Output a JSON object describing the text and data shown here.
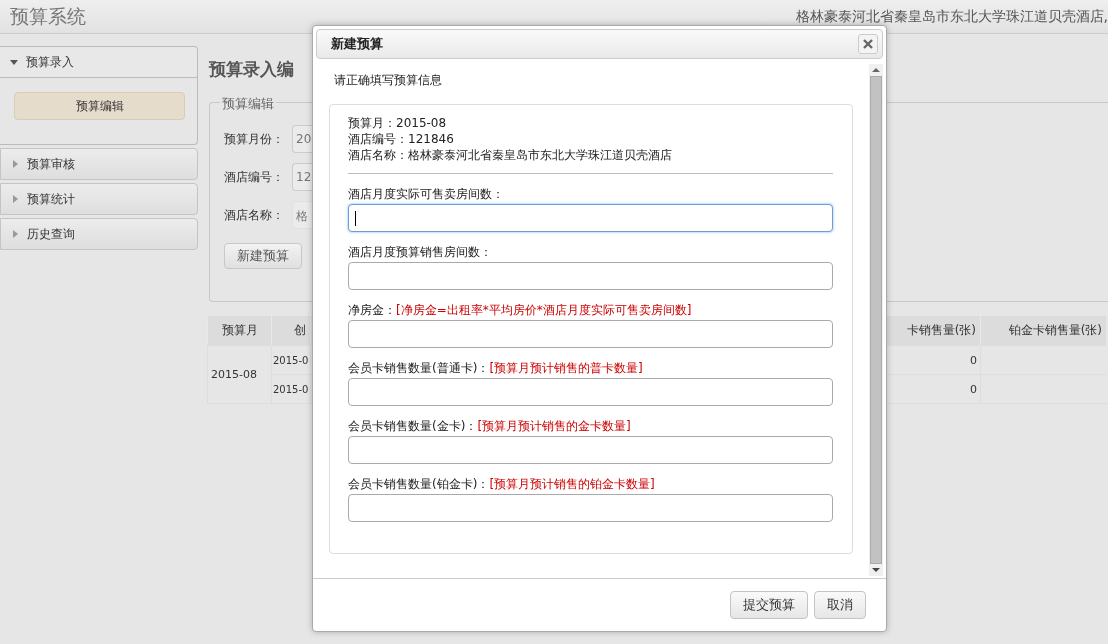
{
  "header": {
    "title": "预算系统",
    "hotel": "格林豪泰河北省秦皇岛市东北大学珠江道贝壳酒店,"
  },
  "sidebar": {
    "sections": [
      {
        "label": "预算录入",
        "expanded": true,
        "items": [
          {
            "label": "预算编辑",
            "selected": true
          }
        ]
      },
      {
        "label": "预算审核",
        "expanded": false
      },
      {
        "label": "预算统计",
        "expanded": false
      },
      {
        "label": "历史查询",
        "expanded": false
      }
    ]
  },
  "main": {
    "title": "预算录入编",
    "fieldset": {
      "legend": "预算编辑",
      "fields": [
        {
          "label": "预算月份：",
          "value": "20"
        },
        {
          "label": "酒店编号：",
          "value": "12"
        },
        {
          "label": "酒店名称：",
          "value": "格"
        }
      ],
      "button": "新建预算"
    },
    "table": {
      "columns": [
        "预算月",
        "创",
        "卡销售量(张)",
        "铂金卡销售量(张)"
      ],
      "groups": [
        {
          "month": "2015-08",
          "rows": [
            {
              "created": "2015-0",
              "gold": "0"
            },
            {
              "created": "2015-0",
              "gold": "0"
            }
          ]
        }
      ]
    }
  },
  "dialog": {
    "title": "新建预算",
    "intro": "请正确填写预算信息",
    "info": [
      "预算月：2015-08",
      "酒店编号：121846",
      "酒店名称：格林豪泰河北省秦皇岛市东北大学珠江道贝壳酒店"
    ],
    "fields": [
      {
        "label": "酒店月度实际可售卖房间数：",
        "focused": true
      },
      {
        "label": "酒店月度预算销售房间数：",
        "focused": false
      },
      {
        "label": "净房金：",
        "hint": "[净房金=出租率*平均房价*酒店月度实际可售卖房间数]",
        "focused": false
      },
      {
        "label": "会员卡销售数量(普通卡)：",
        "hint": "[预算月预计销售的普卡数量]",
        "focused": false
      },
      {
        "label": "会员卡销售数量(金卡)：",
        "hint": "[预算月预计销售的金卡数量]",
        "focused": false
      },
      {
        "label": "会员卡销售数量(铂金卡)：",
        "hint": "[预算月预计销售的铂金卡数量]",
        "focused": false
      }
    ],
    "buttons": [
      "提交预算",
      "取消"
    ]
  }
}
